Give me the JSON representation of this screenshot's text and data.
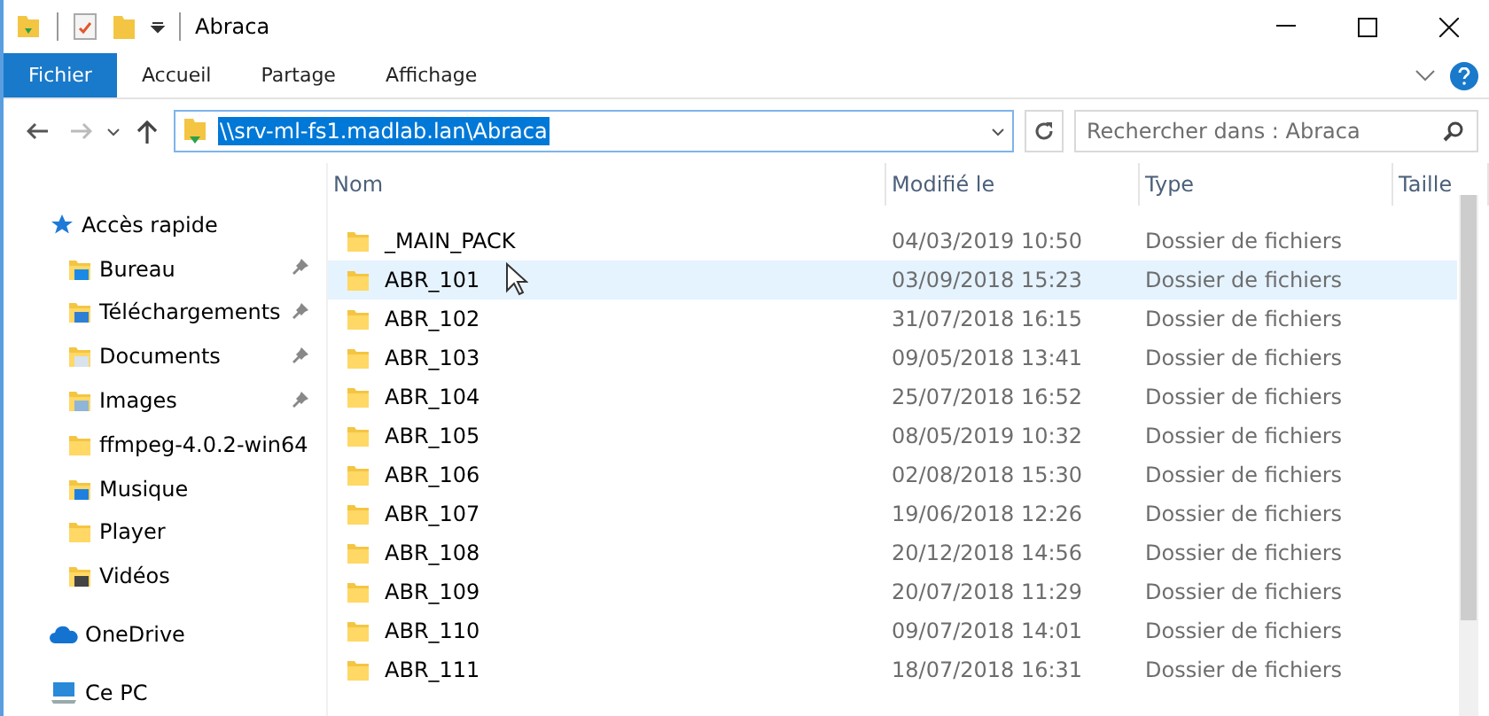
{
  "window": {
    "title": "Abraca"
  },
  "ribbon_tabs": [
    {
      "label": "Fichier",
      "selected": true
    },
    {
      "label": "Accueil",
      "selected": false
    },
    {
      "label": "Partage",
      "selected": false
    },
    {
      "label": "Affichage",
      "selected": false
    }
  ],
  "address": {
    "value": "\\\\srv-ml-fs1.madlab.lan\\Abraca",
    "selected": true
  },
  "search": {
    "placeholder": "Rechercher dans : Abraca"
  },
  "sidebar": {
    "sections": [
      {
        "kind": "quick",
        "label": "Accès rapide",
        "children": [
          {
            "kind": "desktop",
            "label": "Bureau",
            "pinned": true
          },
          {
            "kind": "downloads",
            "label": "Téléchargements",
            "pinned": true
          },
          {
            "kind": "documents",
            "label": "Documents",
            "pinned": true
          },
          {
            "kind": "images",
            "label": "Images",
            "pinned": true
          },
          {
            "kind": "folder",
            "label": "ffmpeg-4.0.2-win64",
            "pinned": false
          },
          {
            "kind": "music",
            "label": "Musique",
            "pinned": false
          },
          {
            "kind": "folder",
            "label": "Player",
            "pinned": false
          },
          {
            "kind": "videos",
            "label": "Vidéos",
            "pinned": false
          }
        ]
      },
      {
        "kind": "cloud",
        "label": "OneDrive"
      },
      {
        "kind": "pc",
        "label": "Ce PC"
      }
    ]
  },
  "table": {
    "columns": [
      "Nom",
      "Modifié le",
      "Type",
      "Taille"
    ],
    "rows": [
      {
        "name": "_MAIN_PACK",
        "modified": "04/03/2019 10:50",
        "type": "Dossier de fichiers",
        "hovered": false
      },
      {
        "name": "ABR_101",
        "modified": "03/09/2018 15:23",
        "type": "Dossier de fichiers",
        "hovered": true
      },
      {
        "name": "ABR_102",
        "modified": "31/07/2018 16:15",
        "type": "Dossier de fichiers",
        "hovered": false
      },
      {
        "name": "ABR_103",
        "modified": "09/05/2018 13:41",
        "type": "Dossier de fichiers",
        "hovered": false
      },
      {
        "name": "ABR_104",
        "modified": "25/07/2018 16:52",
        "type": "Dossier de fichiers",
        "hovered": false
      },
      {
        "name": "ABR_105",
        "modified": "08/05/2019 10:32",
        "type": "Dossier de fichiers",
        "hovered": false
      },
      {
        "name": "ABR_106",
        "modified": "02/08/2018 15:30",
        "type": "Dossier de fichiers",
        "hovered": false
      },
      {
        "name": "ABR_107",
        "modified": "19/06/2018 12:26",
        "type": "Dossier de fichiers",
        "hovered": false
      },
      {
        "name": "ABR_108",
        "modified": "20/12/2018 14:56",
        "type": "Dossier de fichiers",
        "hovered": false
      },
      {
        "name": "ABR_109",
        "modified": "20/07/2018 11:29",
        "type": "Dossier de fichiers",
        "hovered": false
      },
      {
        "name": "ABR_110",
        "modified": "09/07/2018 14:01",
        "type": "Dossier de fichiers",
        "hovered": false
      },
      {
        "name": "ABR_111",
        "modified": "18/07/2018 16:31",
        "type": "Dossier de fichiers",
        "hovered": false
      }
    ]
  }
}
